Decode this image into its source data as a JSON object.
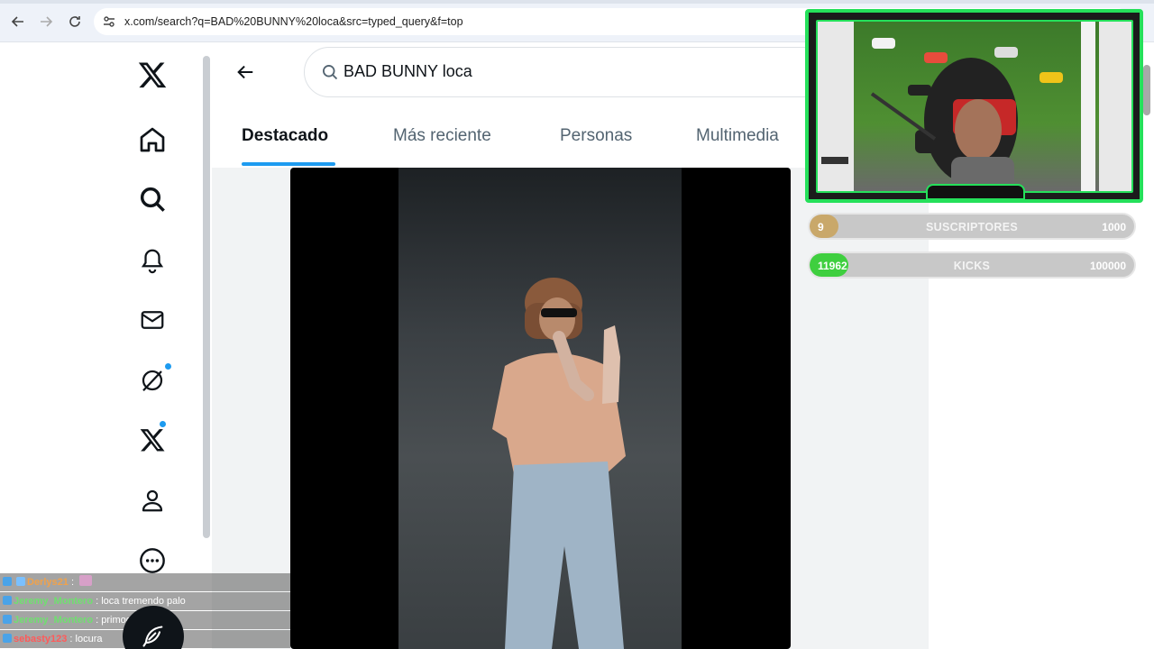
{
  "browser": {
    "url": "x.com/search?q=BAD%20BUNNY%20loca&src=typed_query&f=top"
  },
  "search": {
    "query": "BAD BUNNY loca"
  },
  "tabs": [
    {
      "label": "Destacado",
      "active": true
    },
    {
      "label": "Más reciente",
      "active": false
    },
    {
      "label": "Personas",
      "active": false
    },
    {
      "label": "Multimedia",
      "active": false
    }
  ],
  "sidebar": {
    "items": [
      {
        "icon": "x-logo-icon"
      },
      {
        "icon": "home-icon"
      },
      {
        "icon": "search-icon"
      },
      {
        "icon": "bell-icon"
      },
      {
        "icon": "mail-icon"
      },
      {
        "icon": "grok-icon"
      },
      {
        "icon": "premium-x-icon"
      },
      {
        "icon": "profile-icon"
      },
      {
        "icon": "more-icon"
      }
    ]
  },
  "overlay": {
    "subs": {
      "current": "9",
      "label": "SUSCRIPTORES",
      "goal": "1000",
      "progress": 0.009,
      "color": "#c9a86a"
    },
    "kicks": {
      "current": "11962",
      "label": "KICKS",
      "goal": "100000",
      "progress": 0.1196,
      "color": "#3fcf3f"
    }
  },
  "chat": [
    {
      "user": "Derlys21",
      "sep": ":",
      "message": "",
      "user_color": "#f0a24b",
      "emote": true
    },
    {
      "user": "Jeremy_Montero",
      "sep": ":",
      "message": "loca tremendo palo",
      "user_color": "#6fe06f"
    },
    {
      "user": "Jeremy_Montero",
      "sep": ":",
      "message": "primooooo",
      "user_color": "#6fe06f"
    },
    {
      "user": "sebasty123",
      "sep": ":",
      "message": "locura",
      "user_color": "#ff5a5a"
    }
  ],
  "colors": {
    "accent": "#1d9bf0",
    "text": "#0f1419",
    "overlay_green": "#25e05a"
  }
}
